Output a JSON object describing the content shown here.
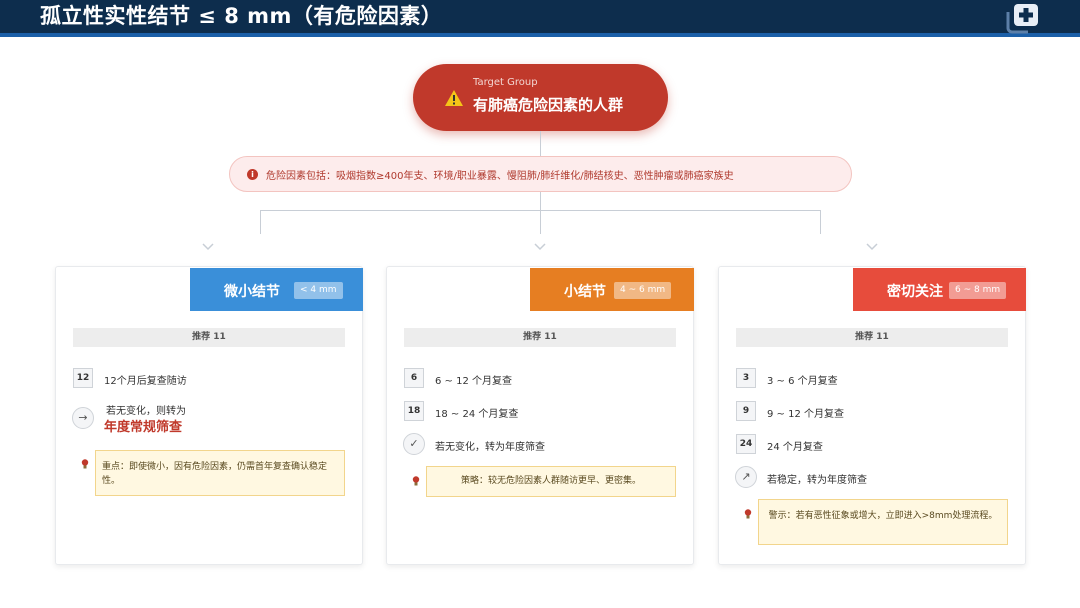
{
  "header": {
    "title": "孤立性实性结节 ≤ 8 mm（有危险因素）",
    "logo_icon": "medical-plus-icon"
  },
  "target": {
    "subtitle": "Target Group",
    "title": "有肺癌危险因素的人群",
    "icon": "warning-icon"
  },
  "risk": {
    "icon": "info-icon",
    "text": "危险因素包括：吸烟指数≥400年支、环境/职业暴露、慢阻肺/肺纤维化/肺结核史、恶性肿瘤或肺癌家族史"
  },
  "cards": [
    {
      "title": "微小结节",
      "chip": "< 4 mm",
      "color": "#3a8fd9",
      "rec": "推荐 11",
      "steps": [
        {
          "badge": "12",
          "text": "12个月后复查随访"
        },
        {
          "icon": "arrow-right-icon",
          "text": "若无变化，则转为",
          "text2": "年度常规筛查"
        }
      ],
      "note": "重点：即使微小，因有危险因素，仍需首年复查确认稳定性。"
    },
    {
      "title": "小结节",
      "chip": "4 ~ 6 mm",
      "color": "#e67e22",
      "rec": "推荐 11",
      "steps": [
        {
          "badge": "6",
          "text": "6 ~ 12 个月复查"
        },
        {
          "badge": "18",
          "text": "18 ~ 24 个月复查"
        },
        {
          "icon": "check-icon",
          "text": "若无变化，转为年度筛查"
        }
      ],
      "note": "策略：较无危险因素人群随访更早、更密集。"
    },
    {
      "title": "密切关注",
      "chip": "6 ~ 8 mm",
      "color": "#e74c3c",
      "rec": "推荐 11",
      "steps": [
        {
          "badge": "3",
          "text": "3 ~ 6 个月复查"
        },
        {
          "badge": "9",
          "text": "9 ~ 12 个月复查"
        },
        {
          "badge": "24",
          "text": "24 个月复查"
        },
        {
          "icon": "trend-up-icon",
          "text": "若稳定，转为年度筛查"
        }
      ],
      "note": "警示：若有恶性征象或增大，立即进入>8mm处理流程。"
    }
  ]
}
